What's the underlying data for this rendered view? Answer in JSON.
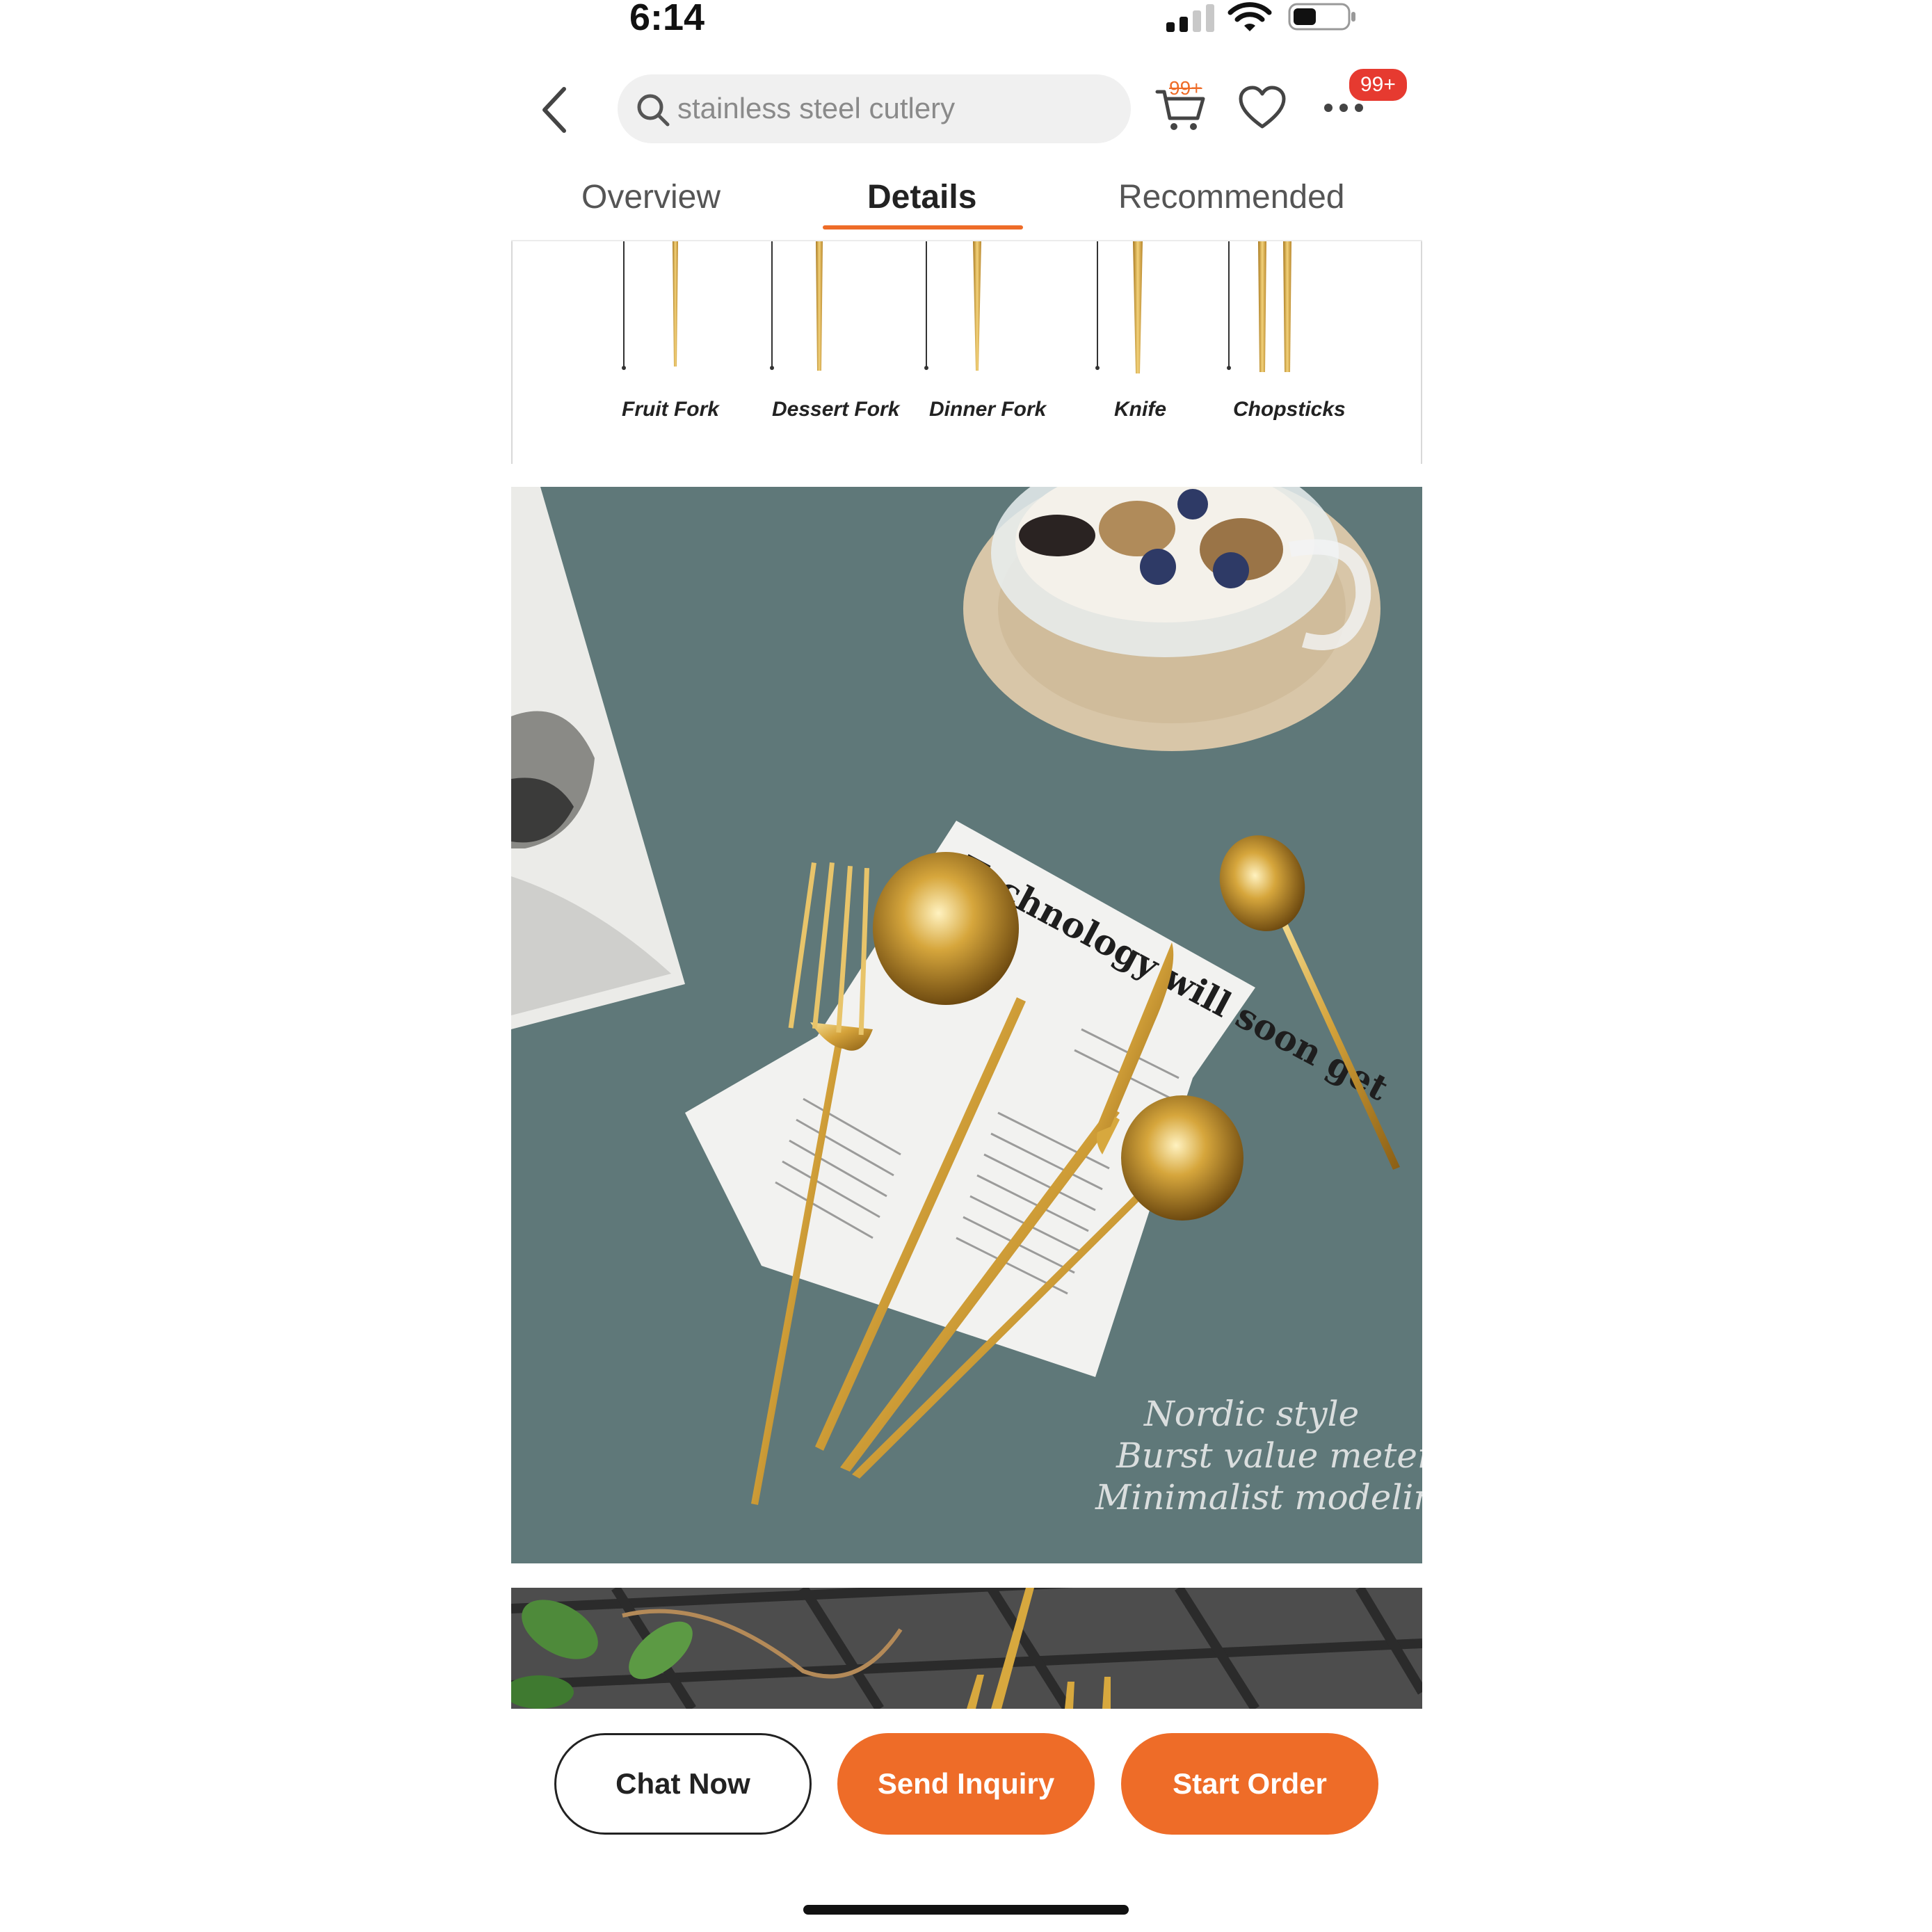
{
  "status_bar": {
    "time": "6:14",
    "signal_icon": "cellular-signal-icon",
    "wifi_icon": "wifi-icon",
    "battery_icon": "battery-icon"
  },
  "header": {
    "back_icon": "chevron-left-icon",
    "search_placeholder": "stainless steel cutlery",
    "search_icon": "search-icon",
    "cart_icon": "cart-icon",
    "cart_badge": "99+",
    "favorite_icon": "heart-icon",
    "more_icon": "more-dots-icon",
    "more_badge": "99+"
  },
  "tabs": [
    {
      "label": "Overview",
      "active": false
    },
    {
      "label": "Details",
      "active": true
    },
    {
      "label": "Recommended",
      "active": false
    }
  ],
  "cutlery_types": [
    "Fruit Fork",
    "Dessert Fork",
    "Dinner Fork",
    "Knife",
    "Chopsticks"
  ],
  "product_image": {
    "newspaper_headline": "Technology will soon get",
    "caption_lines": [
      "Nordic style",
      "Burst value meter",
      "Minimalist modeling"
    ]
  },
  "actions": {
    "chat_now": "Chat Now",
    "send_inquiry": "Send Inquiry",
    "start_order": "Start Order"
  },
  "colors": {
    "accent": "#ee6c28",
    "badge": "#e63a30",
    "table": "#5e7878",
    "gold": "#d9a93a"
  }
}
